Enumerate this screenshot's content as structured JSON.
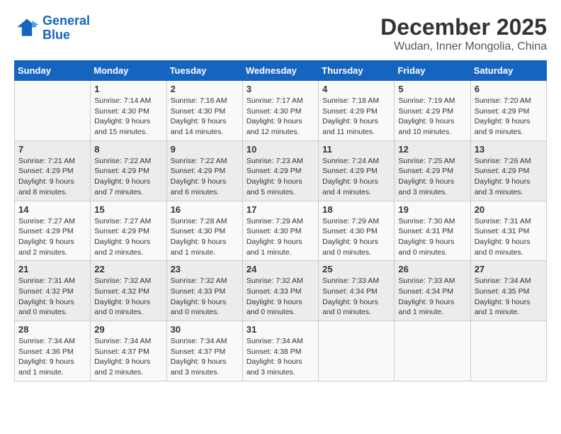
{
  "header": {
    "logo_line1": "General",
    "logo_line2": "Blue",
    "month": "December 2025",
    "location": "Wudan, Inner Mongolia, China"
  },
  "weekdays": [
    "Sunday",
    "Monday",
    "Tuesday",
    "Wednesday",
    "Thursday",
    "Friday",
    "Saturday"
  ],
  "weeks": [
    [
      {
        "day": "",
        "info": ""
      },
      {
        "day": "1",
        "info": "Sunrise: 7:14 AM\nSunset: 4:30 PM\nDaylight: 9 hours\nand 15 minutes."
      },
      {
        "day": "2",
        "info": "Sunrise: 7:16 AM\nSunset: 4:30 PM\nDaylight: 9 hours\nand 14 minutes."
      },
      {
        "day": "3",
        "info": "Sunrise: 7:17 AM\nSunset: 4:30 PM\nDaylight: 9 hours\nand 12 minutes."
      },
      {
        "day": "4",
        "info": "Sunrise: 7:18 AM\nSunset: 4:29 PM\nDaylight: 9 hours\nand 11 minutes."
      },
      {
        "day": "5",
        "info": "Sunrise: 7:19 AM\nSunset: 4:29 PM\nDaylight: 9 hours\nand 10 minutes."
      },
      {
        "day": "6",
        "info": "Sunrise: 7:20 AM\nSunset: 4:29 PM\nDaylight: 9 hours\nand 9 minutes."
      }
    ],
    [
      {
        "day": "7",
        "info": "Sunrise: 7:21 AM\nSunset: 4:29 PM\nDaylight: 9 hours\nand 8 minutes."
      },
      {
        "day": "8",
        "info": "Sunrise: 7:22 AM\nSunset: 4:29 PM\nDaylight: 9 hours\nand 7 minutes."
      },
      {
        "day": "9",
        "info": "Sunrise: 7:22 AM\nSunset: 4:29 PM\nDaylight: 9 hours\nand 6 minutes."
      },
      {
        "day": "10",
        "info": "Sunrise: 7:23 AM\nSunset: 4:29 PM\nDaylight: 9 hours\nand 5 minutes."
      },
      {
        "day": "11",
        "info": "Sunrise: 7:24 AM\nSunset: 4:29 PM\nDaylight: 9 hours\nand 4 minutes."
      },
      {
        "day": "12",
        "info": "Sunrise: 7:25 AM\nSunset: 4:29 PM\nDaylight: 9 hours\nand 3 minutes."
      },
      {
        "day": "13",
        "info": "Sunrise: 7:26 AM\nSunset: 4:29 PM\nDaylight: 9 hours\nand 3 minutes."
      }
    ],
    [
      {
        "day": "14",
        "info": "Sunrise: 7:27 AM\nSunset: 4:29 PM\nDaylight: 9 hours\nand 2 minutes."
      },
      {
        "day": "15",
        "info": "Sunrise: 7:27 AM\nSunset: 4:29 PM\nDaylight: 9 hours\nand 2 minutes."
      },
      {
        "day": "16",
        "info": "Sunrise: 7:28 AM\nSunset: 4:30 PM\nDaylight: 9 hours\nand 1 minute."
      },
      {
        "day": "17",
        "info": "Sunrise: 7:29 AM\nSunset: 4:30 PM\nDaylight: 9 hours\nand 1 minute."
      },
      {
        "day": "18",
        "info": "Sunrise: 7:29 AM\nSunset: 4:30 PM\nDaylight: 9 hours\nand 0 minutes."
      },
      {
        "day": "19",
        "info": "Sunrise: 7:30 AM\nSunset: 4:31 PM\nDaylight: 9 hours\nand 0 minutes."
      },
      {
        "day": "20",
        "info": "Sunrise: 7:31 AM\nSunset: 4:31 PM\nDaylight: 9 hours\nand 0 minutes."
      }
    ],
    [
      {
        "day": "21",
        "info": "Sunrise: 7:31 AM\nSunset: 4:32 PM\nDaylight: 9 hours\nand 0 minutes."
      },
      {
        "day": "22",
        "info": "Sunrise: 7:32 AM\nSunset: 4:32 PM\nDaylight: 9 hours\nand 0 minutes."
      },
      {
        "day": "23",
        "info": "Sunrise: 7:32 AM\nSunset: 4:33 PM\nDaylight: 9 hours\nand 0 minutes."
      },
      {
        "day": "24",
        "info": "Sunrise: 7:32 AM\nSunset: 4:33 PM\nDaylight: 9 hours\nand 0 minutes."
      },
      {
        "day": "25",
        "info": "Sunrise: 7:33 AM\nSunset: 4:34 PM\nDaylight: 9 hours\nand 0 minutes."
      },
      {
        "day": "26",
        "info": "Sunrise: 7:33 AM\nSunset: 4:34 PM\nDaylight: 9 hours\nand 1 minute."
      },
      {
        "day": "27",
        "info": "Sunrise: 7:34 AM\nSunset: 4:35 PM\nDaylight: 9 hours\nand 1 minute."
      }
    ],
    [
      {
        "day": "28",
        "info": "Sunrise: 7:34 AM\nSunset: 4:36 PM\nDaylight: 9 hours\nand 1 minute."
      },
      {
        "day": "29",
        "info": "Sunrise: 7:34 AM\nSunset: 4:37 PM\nDaylight: 9 hours\nand 2 minutes."
      },
      {
        "day": "30",
        "info": "Sunrise: 7:34 AM\nSunset: 4:37 PM\nDaylight: 9 hours\nand 3 minutes."
      },
      {
        "day": "31",
        "info": "Sunrise: 7:34 AM\nSunset: 4:38 PM\nDaylight: 9 hours\nand 3 minutes."
      },
      {
        "day": "",
        "info": ""
      },
      {
        "day": "",
        "info": ""
      },
      {
        "day": "",
        "info": ""
      }
    ]
  ]
}
